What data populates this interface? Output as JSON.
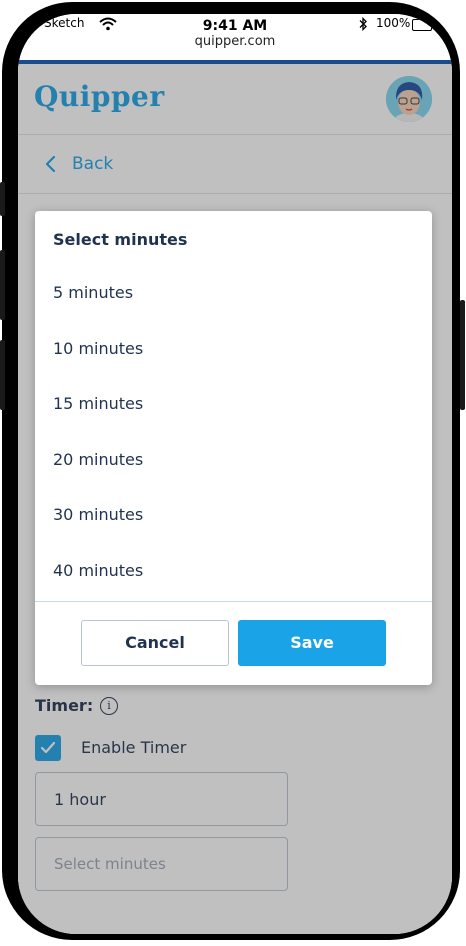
{
  "status_bar": {
    "carrier": "Sketch",
    "time": "9:41 AM",
    "url": "quipper.com",
    "battery": "100%"
  },
  "header": {
    "logo": "Quipper",
    "back_label": "Back"
  },
  "form": {
    "timer_label": "Timer:",
    "enable_timer_label": "Enable Timer",
    "hours_value": "1 hour",
    "minutes_placeholder": "Select minutes"
  },
  "modal": {
    "title": "Select minutes",
    "options": [
      "5 minutes",
      "10 minutes",
      "15 minutes",
      "20 minutes",
      "30 minutes",
      "40 minutes"
    ],
    "cancel_label": "Cancel",
    "save_label": "Save"
  },
  "colors": {
    "brand": "#1aa3e6",
    "text_dark": "#1f3350"
  }
}
